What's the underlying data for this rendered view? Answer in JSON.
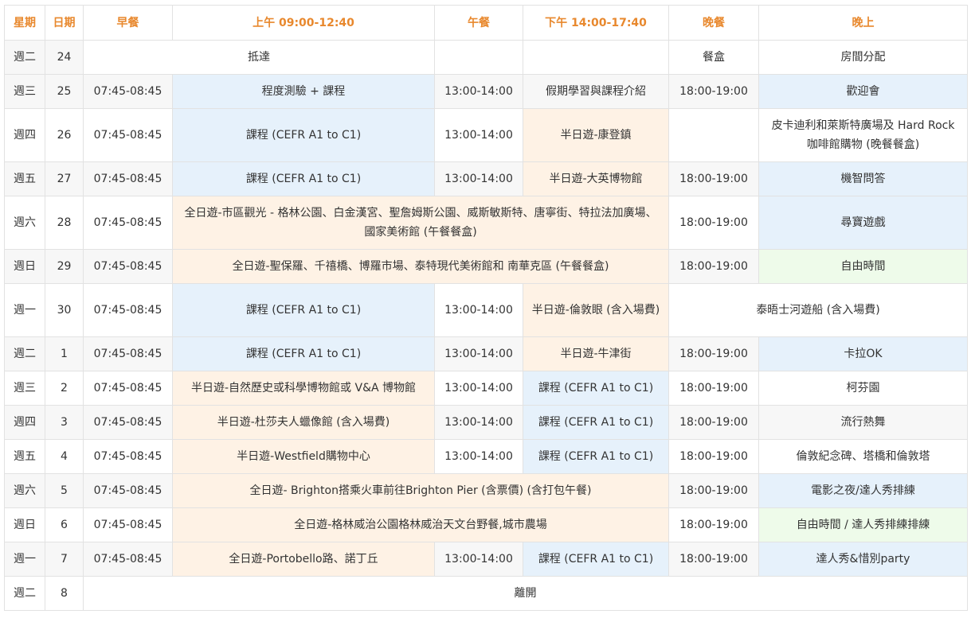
{
  "headers": [
    "星期",
    "日期",
    "早餐",
    "上午 09:00-12:40",
    "午餐",
    "下午 14:00-17:40",
    "晚餐",
    "晚上"
  ],
  "rows": [
    {
      "day": "週二",
      "date": "24",
      "merged": "抵達",
      "dinner": "餐盒",
      "evening": "房間分配"
    },
    {
      "day": "週三",
      "date": "25",
      "breakfast": "07:45-08:45",
      "morning": "程度測驗 + 課程",
      "lunch": "13:00-14:00",
      "afternoon": "假期學習與課程介紹",
      "dinner": "18:00-19:00",
      "evening": "歡迎會"
    },
    {
      "day": "週四",
      "date": "26",
      "breakfast": "07:45-08:45",
      "morning": "課程 (CEFR A1 to C1)",
      "lunch": "13:00-14:00",
      "afternoon": "半日遊-康登鎮",
      "dinner": "",
      "evening": "皮卡迪利和萊斯特廣場及 Hard Rock 咖啡館購物 (晚餐餐盒)"
    },
    {
      "day": "週五",
      "date": "27",
      "breakfast": "07:45-08:45",
      "morning": "課程 (CEFR A1 to C1)",
      "lunch": "13:00-14:00",
      "afternoon": "半日遊-大英博物館",
      "dinner": "18:00-19:00",
      "evening": "機智問答"
    },
    {
      "day": "週六",
      "date": "28",
      "breakfast": "07:45-08:45",
      "fullday": "全日遊-市區觀光 - 格林公園、白金漢宮、聖詹姆斯公園、威斯敏斯特、唐寧街、特拉法加廣場、國家美術館 (午餐餐盒)",
      "dinner": "18:00-19:00",
      "evening": "尋寶遊戲"
    },
    {
      "day": "週日",
      "date": "29",
      "breakfast": "07:45-08:45",
      "fullday": "全日遊-聖保羅、千禧橋、博羅市場、泰特現代美術館和 南華克區 (午餐餐盒)",
      "dinner": "18:00-19:00",
      "evening": "自由時間"
    },
    {
      "day": "週一",
      "date": "30",
      "breakfast": "07:45-08:45",
      "morning": "課程 (CEFR A1 to C1)",
      "lunch": "13:00-14:00",
      "afternoon": "半日遊-倫敦眼 (含入場費)",
      "evening_merged": "泰晤士河遊船 (含入場費)"
    },
    {
      "day": "週二",
      "date": "1",
      "breakfast": "07:45-08:45",
      "morning": "課程 (CEFR A1 to C1)",
      "lunch": "13:00-14:00",
      "afternoon": "半日遊-牛津街",
      "dinner": "18:00-19:00",
      "evening": "卡拉OK"
    },
    {
      "day": "週三",
      "date": "2",
      "breakfast": "07:45-08:45",
      "morning": "半日遊-自然歷史或科學博物館或 V&A 博物館",
      "lunch": "13:00-14:00",
      "afternoon": "課程 (CEFR A1 to C1)",
      "dinner": "18:00-19:00",
      "evening": "柯芬園"
    },
    {
      "day": "週四",
      "date": "3",
      "breakfast": "07:45-08:45",
      "morning": "半日遊-杜莎夫人蠟像館 (含入場費)",
      "lunch": "13:00-14:00",
      "afternoon": "課程 (CEFR A1 to C1)",
      "dinner": "18:00-19:00",
      "evening": "流行熱舞"
    },
    {
      "day": "週五",
      "date": "4",
      "breakfast": "07:45-08:45",
      "morning": "半日遊-Westfield購物中心",
      "lunch": "13:00-14:00",
      "afternoon": "課程 (CEFR A1 to C1)",
      "dinner": "18:00-19:00",
      "evening": "倫敦紀念碑、塔橋和倫敦塔"
    },
    {
      "day": "週六",
      "date": "5",
      "breakfast": "07:45-08:45",
      "fullday": "全日遊- Brighton搭乘火車前往Brighton Pier (含票價) (含打包午餐)",
      "dinner": "18:00-19:00",
      "evening": "電影之夜/達人秀排練"
    },
    {
      "day": "週日",
      "date": "6",
      "breakfast": "07:45-08:45",
      "fullday": "全日遊-格林威治公園格林威治天文台野餐,城市農場",
      "dinner": "18:00-19:00",
      "evening": "自由時間 / 達人秀排練排練"
    },
    {
      "day": "週一",
      "date": "7",
      "breakfast": "07:45-08:45",
      "morning": "全日遊-Portobello路、諾丁丘",
      "lunch": "13:00-14:00",
      "afternoon": "課程 (CEFR A1 to C1)",
      "dinner": "18:00-19:00",
      "evening": "達人秀&惜別party"
    },
    {
      "day": "週二",
      "date": "8",
      "merged": "離開"
    }
  ]
}
